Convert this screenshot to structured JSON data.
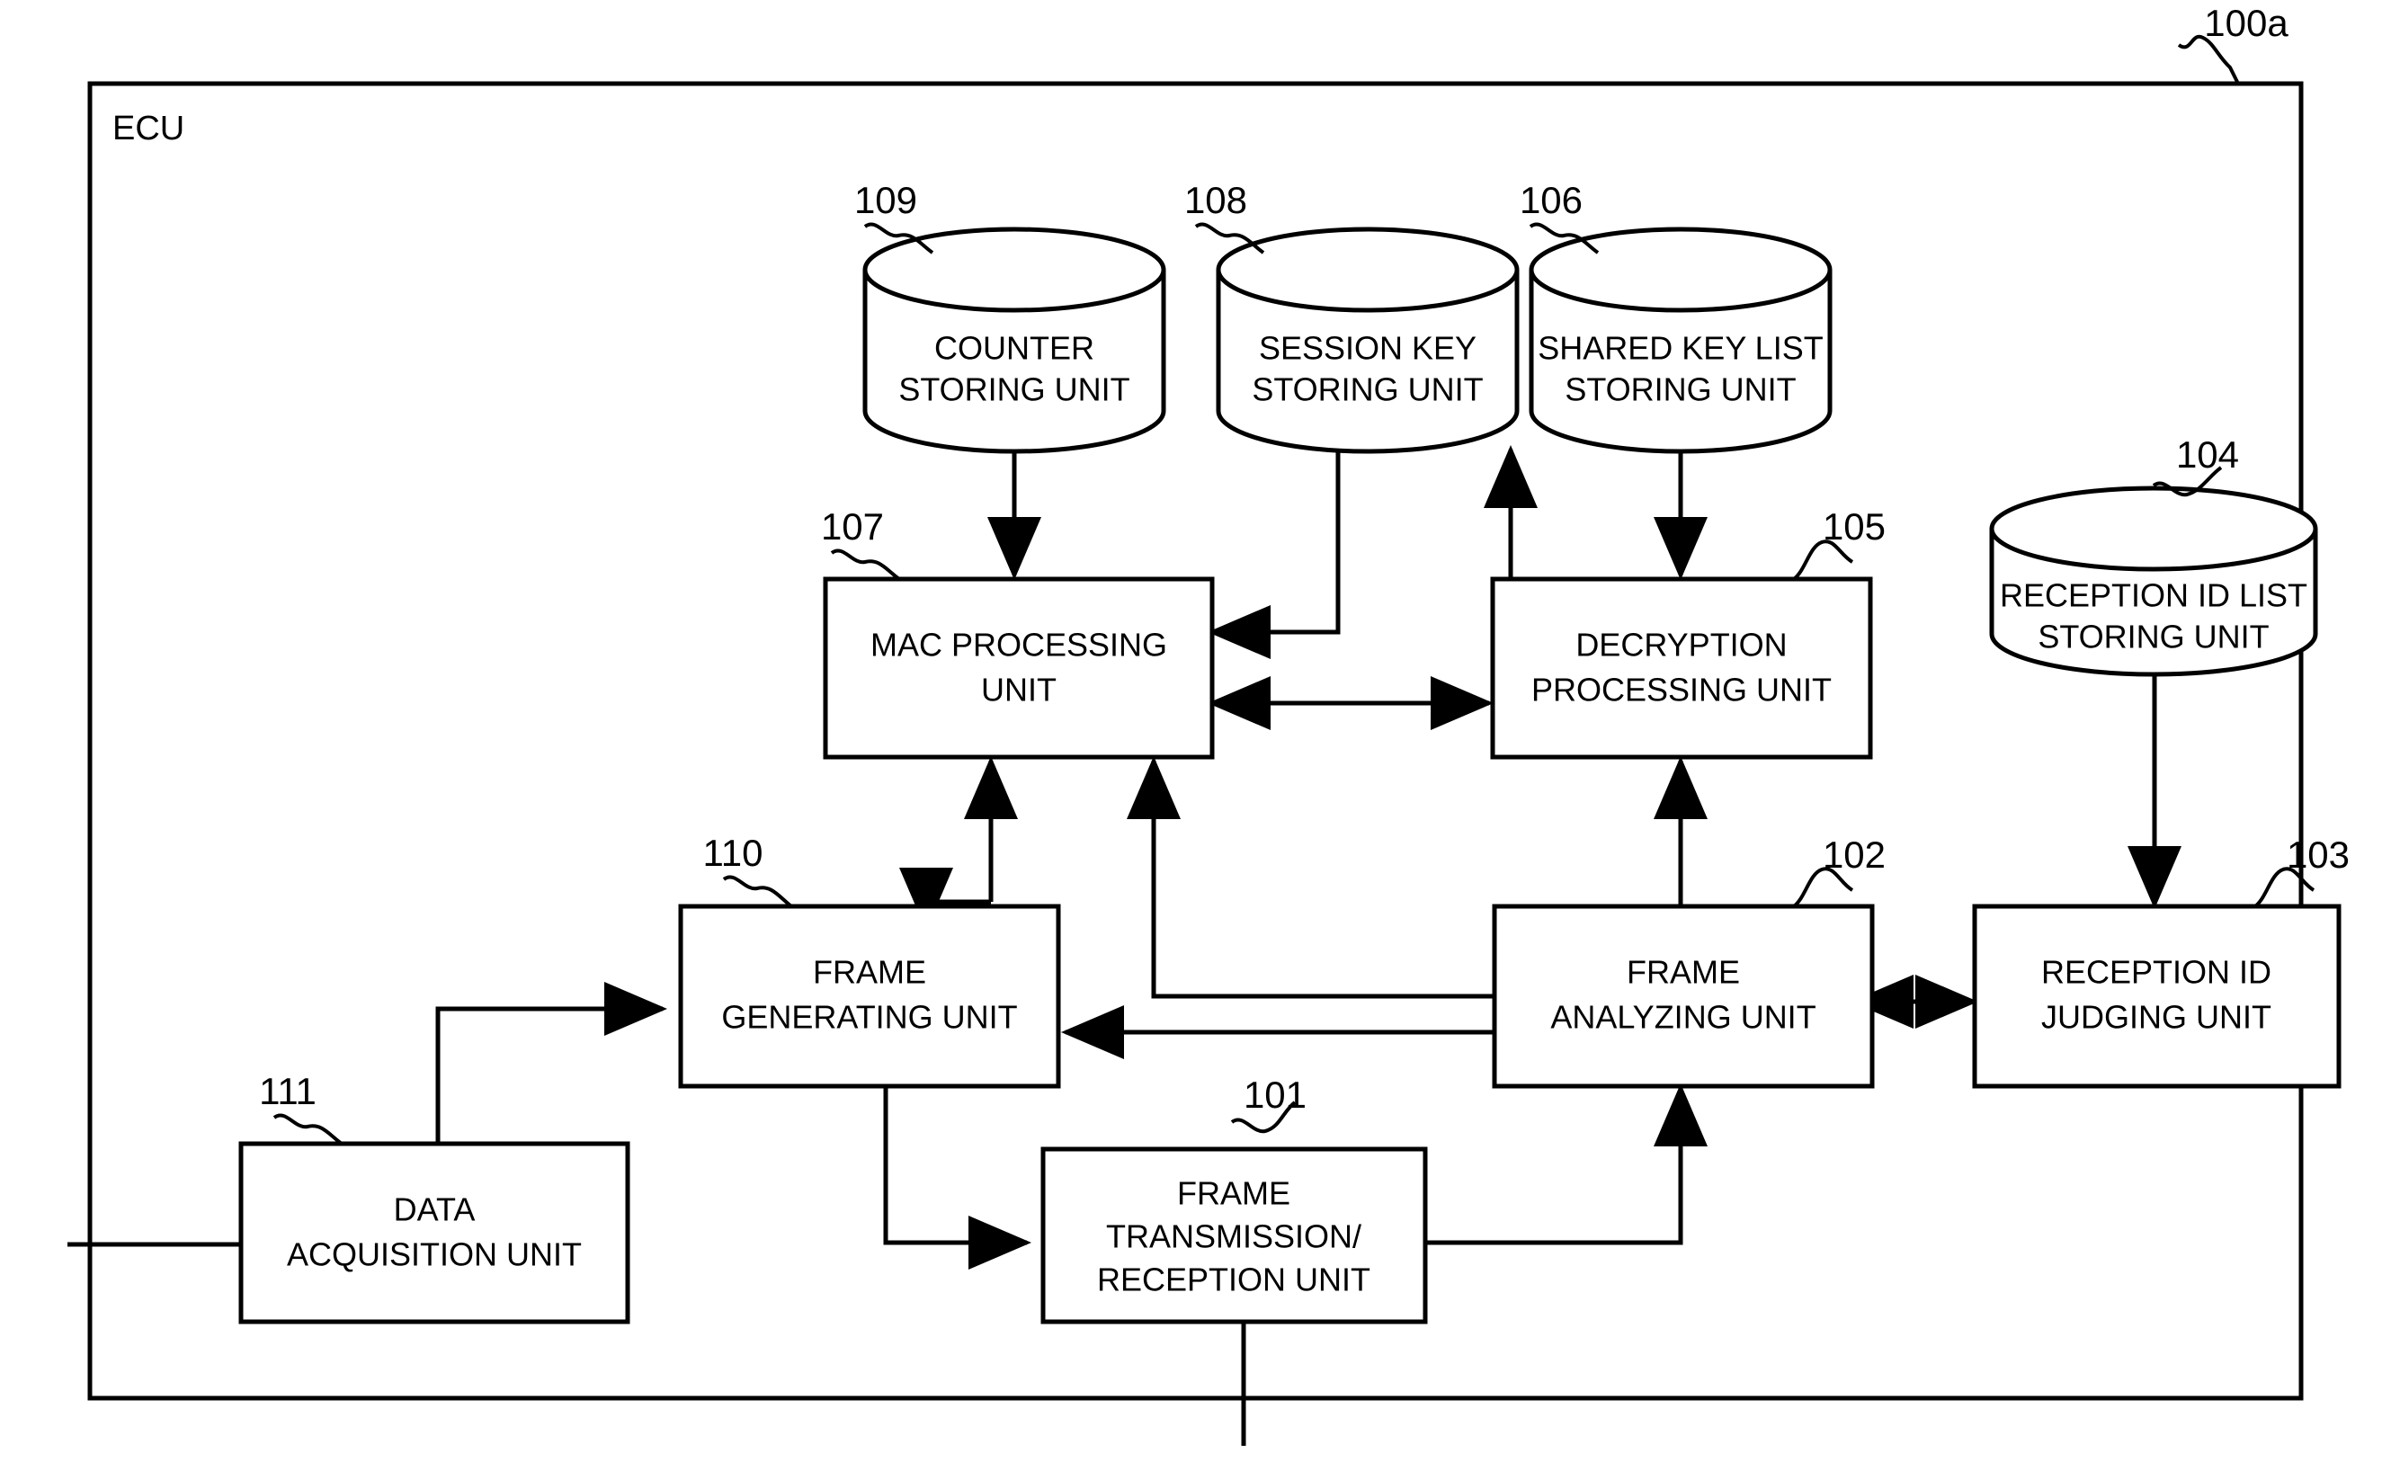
{
  "figure": {
    "outer_label": "ECU",
    "outer_ref": "100a"
  },
  "blocks": [
    {
      "id": "frame-transmission-reception-unit",
      "ref": "101",
      "lines": [
        "FRAME",
        "TRANSMISSION/",
        "RECEPTION UNIT"
      ]
    },
    {
      "id": "frame-analyzing-unit",
      "ref": "102",
      "lines": [
        "FRAME",
        "ANALYZING UNIT"
      ]
    },
    {
      "id": "reception-id-judging-unit",
      "ref": "103",
      "lines": [
        "RECEPTION ID",
        "JUDGING UNIT"
      ]
    },
    {
      "id": "decryption-processing-unit",
      "ref": "105",
      "lines": [
        "DECRYPTION",
        "PROCESSING UNIT"
      ]
    },
    {
      "id": "mac-processing-unit",
      "ref": "107",
      "lines": [
        "MAC PROCESSING",
        "UNIT"
      ]
    },
    {
      "id": "frame-generating-unit",
      "ref": "110",
      "lines": [
        "FRAME",
        "GENERATING UNIT"
      ]
    },
    {
      "id": "data-acquisition-unit",
      "ref": "111",
      "lines": [
        "DATA",
        "ACQUISITION UNIT"
      ]
    }
  ],
  "stores": [
    {
      "id": "reception-id-list-storing-unit",
      "ref": "104",
      "lines": [
        "RECEPTION ID LIST",
        "STORING UNIT"
      ]
    },
    {
      "id": "shared-key-list-storing-unit",
      "ref": "106",
      "lines": [
        "SHARED KEY LIST",
        "STORING UNIT"
      ]
    },
    {
      "id": "session-key-storing-unit",
      "ref": "108",
      "lines": [
        "SESSION KEY",
        "STORING UNIT"
      ]
    },
    {
      "id": "counter-storing-unit",
      "ref": "109",
      "lines": [
        "COUNTER",
        "STORING UNIT"
      ]
    }
  ],
  "colors": {
    "line": "#000000",
    "fill": "#ffffff"
  }
}
